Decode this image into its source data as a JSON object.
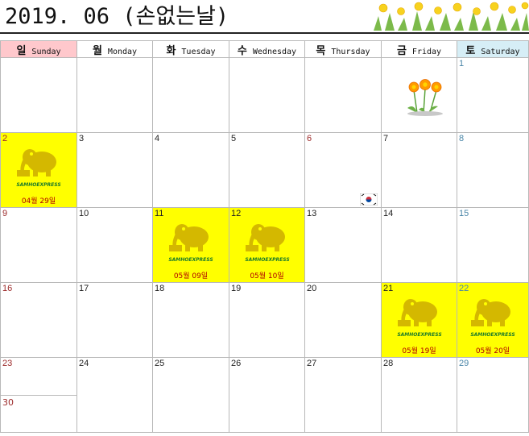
{
  "title": "2019. 06 (손없는날)",
  "days": [
    {
      "ko": "일",
      "en": "Sunday"
    },
    {
      "ko": "월",
      "en": "Monday"
    },
    {
      "ko": "화",
      "en": "Tuesday"
    },
    {
      "ko": "수",
      "en": "Wednesday"
    },
    {
      "ko": "목",
      "en": "Thursday"
    },
    {
      "ko": "금",
      "en": "Friday"
    },
    {
      "ko": "토",
      "en": "Saturday"
    }
  ],
  "dates": {
    "d1": "1",
    "d2": "2",
    "d3": "3",
    "d4": "4",
    "d5": "5",
    "d6": "6",
    "d7": "7",
    "d8": "8",
    "d9": "9",
    "d10": "10",
    "d11": "11",
    "d12": "12",
    "d13": "13",
    "d14": "14",
    "d15": "15",
    "d16": "16",
    "d17": "17",
    "d18": "18",
    "d19": "19",
    "d20": "20",
    "d21": "21",
    "d22": "22",
    "d23": "23",
    "d24": "24",
    "d25": "25",
    "d26": "26",
    "d27": "27",
    "d28": "28",
    "d29": "29",
    "d30": "30"
  },
  "lunar": {
    "d2": "04월 29일",
    "d11": "05월 09일",
    "d12": "05월 10일",
    "d21": "05월 19일",
    "d22": "05월 20일"
  },
  "sticker_brand": "SAMHOEXPRESS",
  "colors": {
    "highlight": "#ffff00",
    "sunday_header": "#ffc8cc",
    "saturday_header": "#d6eef6",
    "lunar_text": "#b00000"
  },
  "icons": [
    "dandelion-icon",
    "elephant-logo-icon",
    "korean-flag-icon",
    "flower-border-icon"
  ]
}
